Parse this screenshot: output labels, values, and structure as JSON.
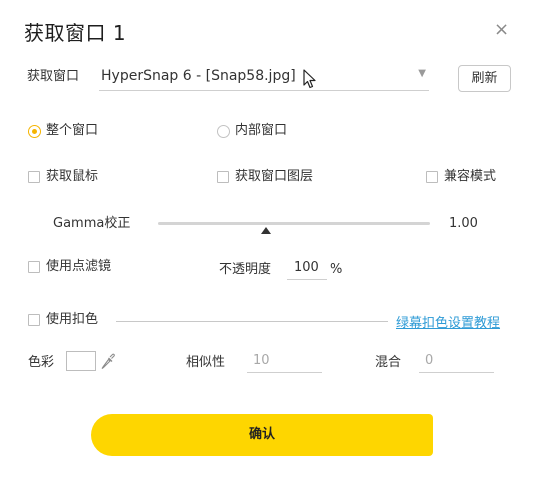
{
  "dialog": {
    "title": "获取窗口 1",
    "close_glyph": "×"
  },
  "capture_window": {
    "label": "获取窗口",
    "selected": "HyperSnap 6 - [Snap58.jpg]",
    "dropdown_glyph": "▼",
    "refresh_label": "刷新"
  },
  "window_mode": {
    "options": [
      {
        "label": "整个窗口",
        "selected": true
      },
      {
        "label": "内部窗口",
        "selected": false
      }
    ]
  },
  "options": {
    "capture_cursor": {
      "label": "获取鼠标",
      "checked": false
    },
    "capture_window_layers": {
      "label": "获取窗口图层",
      "checked": false
    },
    "compat_mode": {
      "label": "兼容模式",
      "checked": false
    }
  },
  "gamma": {
    "label": "Gamma校正",
    "value": "1.00"
  },
  "dot_filter": {
    "label": "使用点滤镜",
    "checked": false,
    "opacity_label": "不透明度",
    "opacity_value": "100",
    "opacity_unit": "%"
  },
  "chroma_key": {
    "label": "使用扣色",
    "checked": false,
    "tutorial_link": "绿幕扣色设置教程",
    "color_label": "色彩",
    "color_value": "#ffffff",
    "similarity_label": "相似性",
    "similarity_value": "10",
    "blend_label": "混合",
    "blend_value": "0"
  },
  "confirm_label": "确认",
  "colors": {
    "accent_yellow": "#fed600",
    "radio_yellow": "#f5b400",
    "link_blue": "#2e9bd6"
  }
}
